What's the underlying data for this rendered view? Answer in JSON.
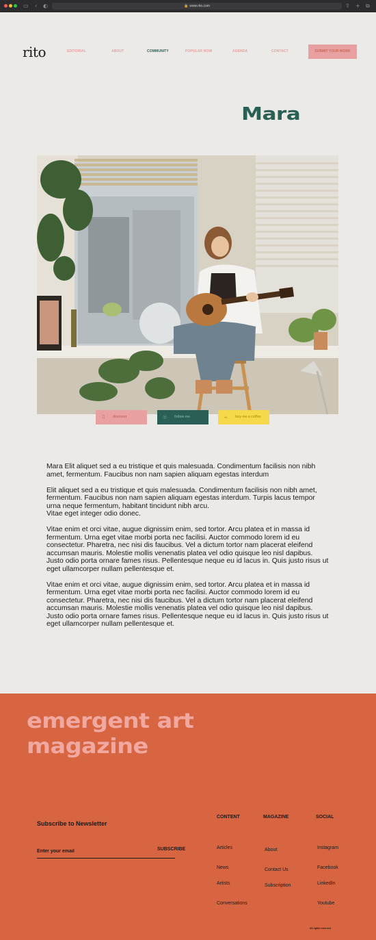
{
  "browser": {
    "url": "www.rito.com"
  },
  "nav": {
    "logo": "rito",
    "items": [
      {
        "label": "EDITORIAL"
      },
      {
        "label": "ABOUT"
      },
      {
        "label": "COMMUNITY"
      },
      {
        "label": "POPULAR NOW"
      },
      {
        "label": "AGENDA"
      },
      {
        "label": "CONTACT"
      }
    ],
    "active_item": "COMMUNITY",
    "submit_label": "SUBMIT YOUR WORK"
  },
  "artist": {
    "name": "Mara"
  },
  "actions": {
    "discover_label": "discover",
    "follow_label": "follow me",
    "coffee_label": "buy me a coffee"
  },
  "article": {
    "paragraphs": [
      "Mara Elit aliquet sed a eu tristique et quis malesuada. Condimentum facilisis non nibh amet, fermentum. Faucibus non nam sapien aliquam egestas interdum",
      "Elit aliquet sed a eu tristique et quis malesuada. Condimentum facilisis non nibh amet, fermentum. Faucibus non nam sapien aliquam egestas interdum. Turpis lacus tempor urna neque fermentum, habitant tincidunt nibh arcu.\nVitae eget integer odio donec.",
      "Vitae enim et orci vitae, augue dignissim enim, sed tortor. Arcu platea et in massa id fermentum. Urna eget vitae morbi porta nec facilisi. Auctor commodo lorem id eu consectetur. Pharetra, nec nisi dis faucibus. Vel a dictum tortor nam placerat eleifend accumsan mauris. Molestie mollis venenatis platea vel odio quisque leo nisl dapibus. Justo odio porta ornare fames risus. Pellentesque neque eu id lacus in. Quis justo risus ut eget ullamcorper nullam pellentesque et.",
      "Vitae enim et orci vitae, augue dignissim enim, sed tortor. Arcu platea et in massa id fermentum. Urna eget vitae morbi porta nec facilisi. Auctor commodo lorem id eu consectetur. Pharetra, nec nisi dis faucibus. Vel a dictum tortor nam placerat eleifend accumsan mauris. Molestie mollis venenatis platea vel odio quisque leo nisl dapibus. Justo odio porta ornare fames risus. Pellentesque neque eu id lacus in. Quis justo risus ut eget ullamcorper nullam pellentesque et."
    ]
  },
  "footer": {
    "title_line1": "emergent art",
    "title_line2": "magazine",
    "newsletter": {
      "heading": "Subscribe to Newsletter",
      "email_placeholder": "Enter your email",
      "subscribe_label": "SUBSCRIBE"
    },
    "columns": [
      {
        "heading": "CONTENT",
        "links": [
          "Articles",
          "News",
          "Artists",
          "Conversations"
        ]
      },
      {
        "heading": "MAGAZINE",
        "links": [
          "About",
          "Contact Us",
          "Subscription"
        ]
      },
      {
        "heading": "SOCIAL",
        "links": [
          "Instagram",
          "Facebook",
          "LinkedIn",
          "Youtube"
        ]
      }
    ],
    "rights": "All rights reserved"
  },
  "colors": {
    "background": "#ebeae6",
    "brand_green": "#2a5f56",
    "brand_pink": "#e8a0a0",
    "brand_orange": "#d86541",
    "brand_yellow": "#f5d94a"
  },
  "icons": {
    "discover": "headphones-icon",
    "follow": "instagram-icon",
    "coffee": "coffee-cup-icon"
  }
}
